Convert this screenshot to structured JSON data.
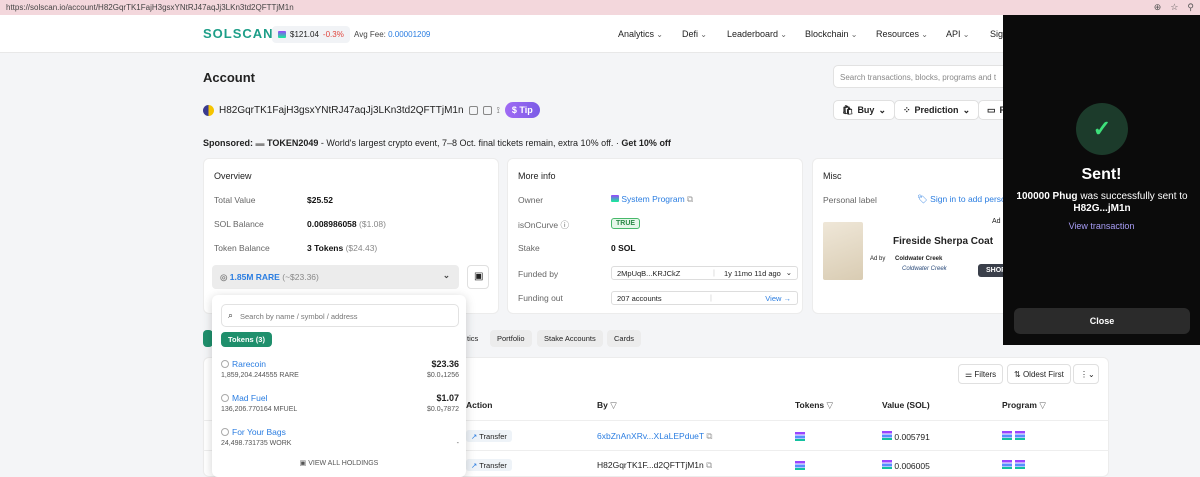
{
  "browser": {
    "url": "https://solscan.io/account/H82GqrTK1FajH3gsxYNtRJ47aqJj3LKn3td2QFTTjM1n"
  },
  "nav": {
    "logo": "SOLSCAN",
    "price": "$121.04",
    "change": "-0.3%",
    "fee_label": "Avg Fee:",
    "fee_value": "0.00001209",
    "items": [
      "Analytics",
      "Defi",
      "Leaderboard",
      "Blockchain",
      "Resources",
      "API",
      "Sig"
    ]
  },
  "account": {
    "title": "Account",
    "address": "H82GqrTK1FajH3gsxYNtRJ47aqJj3LKn3td2QFTTjM1n",
    "tip": "Tip",
    "search_placeholder": "Search transactions, blocks, programs and t",
    "buy": "Buy",
    "prediction": "Prediction",
    "p_partial": "P"
  },
  "sponsor": {
    "label": "Sponsored:",
    "name": "TOKEN2049",
    "text": " - World's largest crypto event, 7–8 Oct. final tickets remain, extra 10% off. · ",
    "cta": "Get 10% off"
  },
  "overview": {
    "title": "Overview",
    "total_value_label": "Total Value",
    "total_value": "$25.52",
    "sol_balance_label": "SOL Balance",
    "sol_balance": "0.008986058",
    "sol_usd": "($1.08)",
    "token_balance_label": "Token Balance",
    "token_balance": "3 Tokens",
    "token_usd": "($24.43)",
    "dropdown_value": "1.85M RARE",
    "dropdown_usd": "(~$23.36)"
  },
  "moreinfo": {
    "title": "More info",
    "owner_label": "Owner",
    "owner": "System Program",
    "oncurve_label": "isOnCurve",
    "oncurve": "TRUE",
    "stake_label": "Stake",
    "stake": "0 SOL",
    "funded_label": "Funded by",
    "funded_by": "2MpUqB...KRJCkZ",
    "funded_age": "1y 11mo 11d ago",
    "funding_out_label": "Funding out",
    "funding_out": "207 accounts",
    "view": "View →"
  },
  "misc": {
    "title": "Misc",
    "personal_label": "Personal label",
    "signin": "Sign in to add perso",
    "ad_label": "Ad",
    "ad_title": "Fireside Sherpa Coat",
    "ad_by": "Ad by",
    "ad_brand": "Coldwater Creek",
    "ad_brand_logo": "Coldwater Creek",
    "ad_cta": "SHOP"
  },
  "tabs": [
    "tics",
    "Portfolio",
    "Stake Accounts",
    "Cards"
  ],
  "table": {
    "filters": "Filters",
    "sort": "Oldest First",
    "headers": {
      "action": "Action",
      "by": "By",
      "tokens": "Tokens",
      "value": "Value (SOL)",
      "program": "Program"
    },
    "rows": [
      {
        "action": "Transfer",
        "by": "6xbZnAnXRv...XLaLEPdueT",
        "value": "0.005791"
      },
      {
        "action": "Transfer",
        "by": "H82GqrTK1F...d2QFTTjM1n",
        "value": "0.006005"
      }
    ]
  },
  "dropdown": {
    "search_placeholder": "Search by name / symbol / address",
    "tab": "Tokens (3)",
    "tokens": [
      {
        "name": "Rarecoin",
        "amount": "1,859,204.244555 RARE",
        "value": "$23.36",
        "price": "$0.0₄1256"
      },
      {
        "name": "Mad Fuel",
        "amount": "136,206.770164 MFUEL",
        "value": "$1.07",
        "price": "$0.0₅7872"
      },
      {
        "name": "For Your Bags",
        "amount": "24,498.731735 WORK",
        "value": "",
        "price": "-"
      }
    ],
    "view_all": "VIEW ALL HOLDINGS"
  },
  "sent_panel": {
    "title": "Sent!",
    "amount": "100000 Phug",
    "msg_mid": " was successfully sent to ",
    "recipient": "H82G...jM1n",
    "view_tx": "View transaction",
    "close": "Close"
  }
}
